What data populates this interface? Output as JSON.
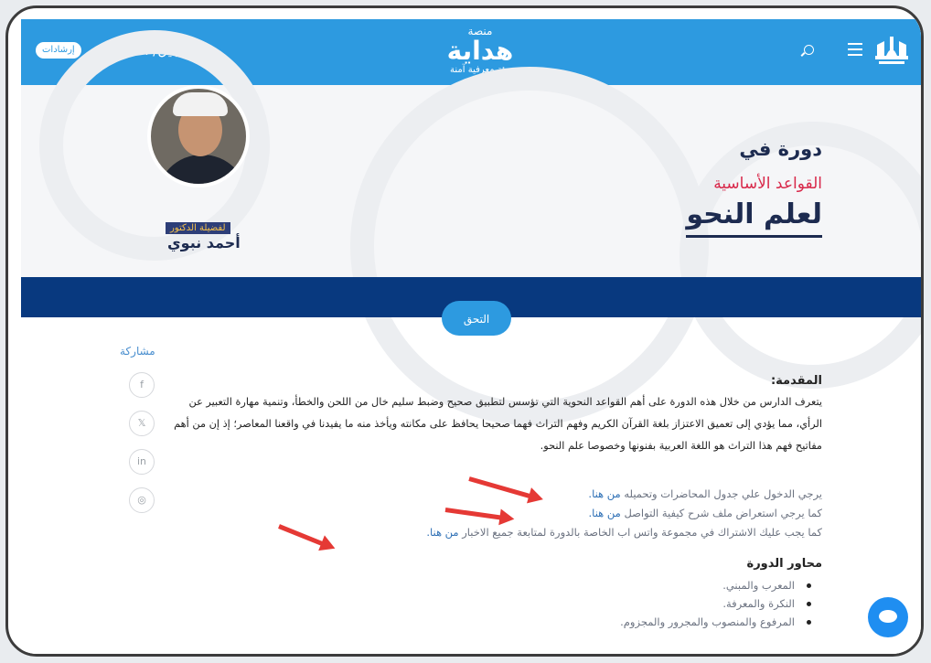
{
  "header": {
    "guide_label": "إرشادات",
    "login_label": "التسجيل/ الدخول",
    "brand_small": "منصة",
    "brand_name": "هداية",
    "brand_tagline": "بيئة معرفية آمنة"
  },
  "hero": {
    "course_prefix": "دورة في",
    "course_subtitle": "القواعد الأساسية",
    "course_title": "لعلم النحو",
    "lecturer_label": "لفضيلة الدكتور",
    "lecturer_name": "أحمد نبوي"
  },
  "join_button": "التحق",
  "share": {
    "label": "مشاركة",
    "buttons": [
      "f",
      "𝕏",
      "in",
      "◎"
    ]
  },
  "content": {
    "intro_heading": "المقدمة:",
    "intro_text": "يتعرف الدارس من خلال هذه الدورة على أهم القواعد النحوية التي تؤسس لتطبيق صحيح وضبط سليم خال من اللحن والخطأ، وتنمية مهارة التعبير عن الرأي، مما يؤدي إلى تعميق الاعتزاز بلغة القرآن الكريم وفهم التراث فهما صحيحا يحافظ على مكانته ويأخذ منه ما يفيدنا في واقعنا المعاصر؛ إذ إن من أهم مفاتيح فهم هذا التراث هو اللغة العربية بفنونها وخصوصا علم النحو.",
    "notes": [
      {
        "text": "يرجي الدخول علي جدول المحاضرات وتحميله",
        "link": "من هنا."
      },
      {
        "text": "كما يرجي استعراض ملف شرح كيفية التواصل",
        "link": "من هنا."
      },
      {
        "text": "كما يجب عليك الاشتراك في مجموعة واتس اب الخاصة بالدورة لمتابعة جميع الاخبار",
        "link": "من هنا."
      }
    ],
    "axes_heading": "محاور الدورة",
    "axes": [
      "المعرب والمبني.",
      "النكرة والمعرفة.",
      "المرفوع والمنصوب والمجرور والمجزوم."
    ]
  },
  "colors": {
    "header_blue": "#2d9ae0",
    "navy": "#08397f",
    "accent_red": "#d8284a",
    "arrow_red": "#e53935"
  }
}
